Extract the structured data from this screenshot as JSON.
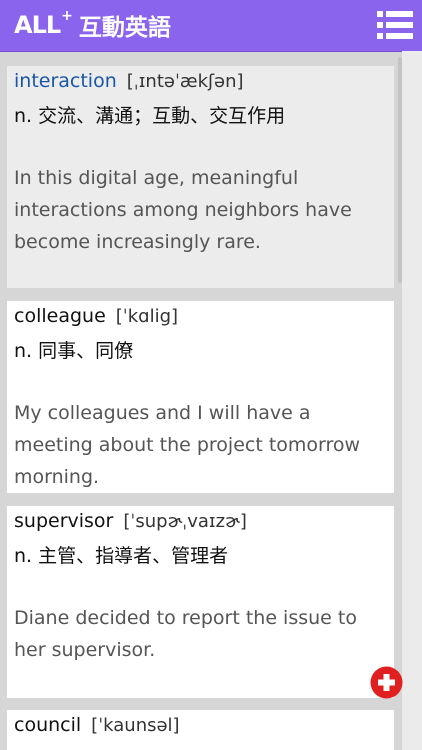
{
  "header": {
    "logo_mark": "ALL",
    "logo_plus": "+",
    "app_title": "互動英語",
    "brand_color": "#8a64ec",
    "menu_icon": "list-menu-icon"
  },
  "entries": [
    {
      "word": "interaction",
      "phonetic": "[ˌɪntəˈækʃən]",
      "definition": "n.  交流、溝通；互動、交互作用",
      "example": "In this digital age, meaningful interactions among neighbors have become increasingly rare."
    },
    {
      "word": "colleague",
      "phonetic": "[ˈkɑlig]",
      "definition": "n.  同事、同僚",
      "example": "My colleagues and I will have a meeting about the project tomorrow morning."
    },
    {
      "word": "supervisor",
      "phonetic": "[ˈsupɚˌvaɪzɚ]",
      "definition": "n.  主管、指導者、管理者",
      "example": "Diane decided to report the issue to her supervisor."
    },
    {
      "word": "council",
      "phonetic": "[ˈkaunsəl]",
      "definition": "",
      "example": ""
    }
  ],
  "fab": {
    "icon": "add-circle-icon",
    "color": "#e0201e"
  }
}
